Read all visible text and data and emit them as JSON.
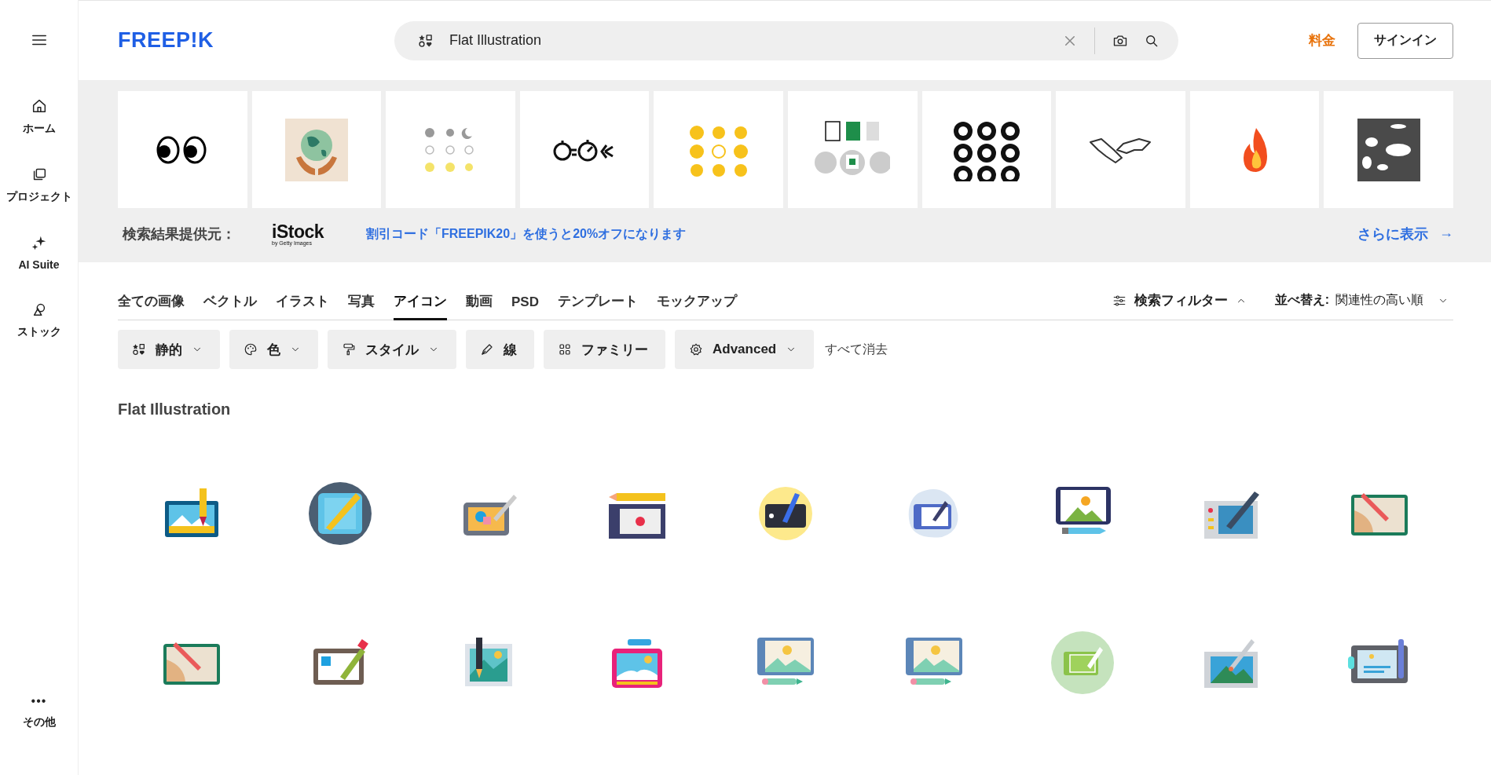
{
  "header": {
    "logo": "FREEP!K",
    "search": {
      "value": "Flat Illustration"
    },
    "pricing": "料金",
    "signin": "サインイン"
  },
  "sidebar": {
    "items": [
      {
        "kind": "home",
        "label": "ホーム"
      },
      {
        "kind": "project",
        "label": "プロジェクト"
      },
      {
        "kind": "ai",
        "label": "AI Suite"
      },
      {
        "kind": "stock",
        "label": "ストック"
      }
    ],
    "more": {
      "glyph": "•••",
      "label": "その他"
    }
  },
  "sponsor": {
    "label": "検索結果提供元：",
    "brand": "iStock",
    "brand_sub": "by Getty Images",
    "promo": "割引コード「FREEPIK20」を使うと20%オフになります",
    "more": "さらに表示",
    "arrow": "→"
  },
  "tabs": [
    {
      "label": "全ての画像",
      "selected": false
    },
    {
      "label": "ベクトル",
      "selected": false
    },
    {
      "label": "イラスト",
      "selected": false
    },
    {
      "label": "写真",
      "selected": false
    },
    {
      "label": "アイコン",
      "selected": true
    },
    {
      "label": "動画",
      "selected": false
    },
    {
      "label": "PSD",
      "selected": false
    },
    {
      "label": "テンプレート",
      "selected": false
    },
    {
      "label": "モックアップ",
      "selected": false
    }
  ],
  "filter_toggle": {
    "label": "検索フィルター",
    "expanded": true
  },
  "sort": {
    "label": "並べ替え:",
    "value": "関連性の高い順"
  },
  "filters": [
    {
      "kind": "shapes",
      "label": "静的",
      "dropdown": true
    },
    {
      "kind": "palette",
      "label": "色",
      "dropdown": true
    },
    {
      "kind": "brush",
      "label": "スタイル",
      "dropdown": true
    },
    {
      "kind": "pen",
      "label": "線",
      "dropdown": false
    },
    {
      "kind": "grid",
      "label": "ファミリー",
      "dropdown": false
    },
    {
      "kind": "gear",
      "label": "Advanced",
      "dropdown": true
    }
  ],
  "clear_all": "すべて消去",
  "heading": "Flat Illustration"
}
